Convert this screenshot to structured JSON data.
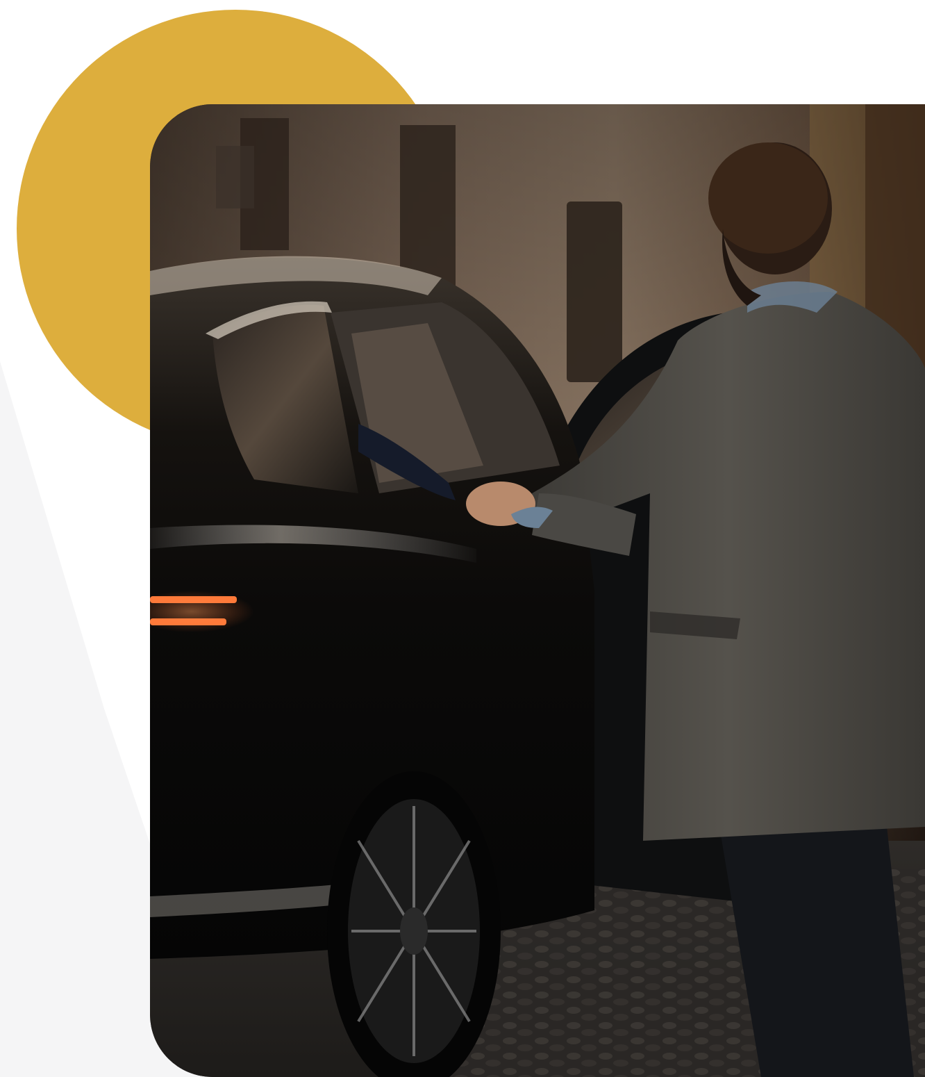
{
  "scene": {
    "accent_color": "#DDAE3D",
    "background_color": "#ffffff",
    "soft_shape_color": "#f5f5f6"
  }
}
